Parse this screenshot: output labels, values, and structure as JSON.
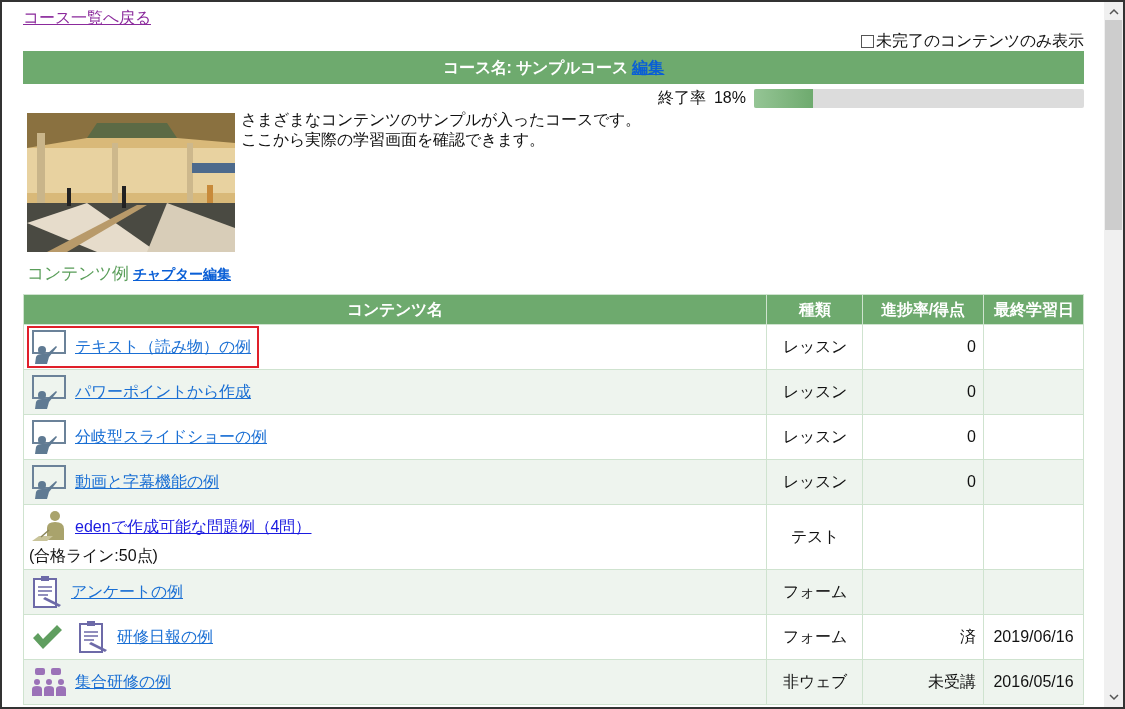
{
  "back_link": "コース一覧へ戻る",
  "filter": {
    "label": "未完了のコンテンツのみ表示",
    "checked": false
  },
  "course_header": {
    "title": "コース名: サンプルコース",
    "edit_link": "編集"
  },
  "completion": {
    "label": "終了率",
    "reading": "18%",
    "level": 0.18
  },
  "description": [
    "さまざまなコンテンツのサンプルが入ったコースです。",
    "ここから実際の学習画面を確認できます。"
  ],
  "section": {
    "title": "コンテンツ例",
    "edit_link": "チャプター編集"
  },
  "table": {
    "columns": [
      "コンテンツ名",
      "種類",
      "進捗率/得点",
      "最終学習日"
    ],
    "rows": [
      {
        "kind": "lesson",
        "name": "テキスト（読み物）の例",
        "highlighted": true,
        "completed": false,
        "type": "レッスン",
        "progress": "0"
      },
      {
        "kind": "lesson",
        "name": "パワーポイントから作成",
        "highlighted": false,
        "completed": false,
        "type": "レッスン",
        "progress": "0"
      },
      {
        "kind": "lesson",
        "name": "分岐型スライドショーの例",
        "highlighted": false,
        "completed": false,
        "type": "レッスン",
        "progress": "0"
      },
      {
        "kind": "lesson",
        "name": "動画と字幕機能の例",
        "highlighted": false,
        "completed": false,
        "type": "レッスン",
        "progress": "0"
      },
      {
        "kind": "test",
        "name": "edenで作成可能な問題例（4問）",
        "note": "(合格ライン:50点)",
        "highlighted": false,
        "completed": false,
        "type": "テスト"
      },
      {
        "kind": "form",
        "name": "アンケートの例",
        "highlighted": false,
        "completed": false,
        "type": "フォーム"
      },
      {
        "kind": "form",
        "name": "研修日報の例",
        "highlighted": false,
        "completed": true,
        "type": "フォーム",
        "progress": "済",
        "date": "2019/06/16"
      },
      {
        "kind": "meeting",
        "name": "集合研修の例",
        "highlighted": false,
        "completed": false,
        "type": "非ウェブ",
        "progress": "未受講",
        "date": "2016/05/16"
      }
    ]
  }
}
